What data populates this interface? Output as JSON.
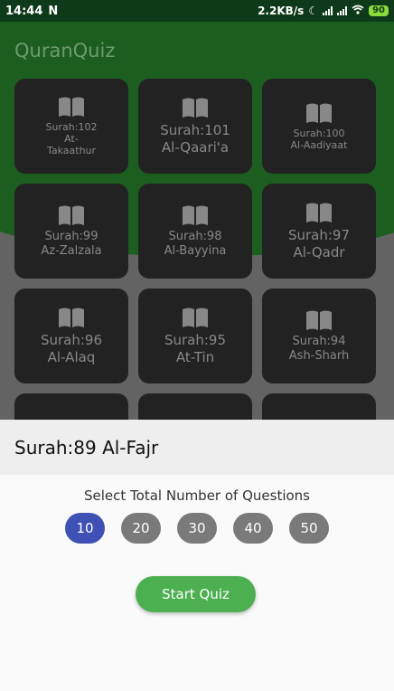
{
  "status": {
    "time": "14:44",
    "notification": "N",
    "speed": "2.2KB/s",
    "battery": "90"
  },
  "app": {
    "title": "QuranQuiz"
  },
  "surahs": [
    {
      "num": "Surah:102",
      "name": "At-\nTakaathur",
      "size": "small"
    },
    {
      "num": "Surah:101",
      "name": "Al-Qaari'a",
      "size": "big"
    },
    {
      "num": "Surah:100",
      "name": "Al-Aadiyaat",
      "size": "small"
    },
    {
      "num": "Surah:99",
      "name": "Az-Zalzala",
      "size": "normal"
    },
    {
      "num": "Surah:98",
      "name": "Al-Bayyina",
      "size": "normal"
    },
    {
      "num": "Surah:97",
      "name": "Al-Qadr",
      "size": "big"
    },
    {
      "num": "Surah:96",
      "name": "Al-Alaq",
      "size": "big"
    },
    {
      "num": "Surah:95",
      "name": "At-Tin",
      "size": "big"
    },
    {
      "num": "Surah:94",
      "name": "Ash-Sharh",
      "size": "normal"
    },
    {
      "num": "",
      "name": "",
      "size": "normal"
    },
    {
      "num": "",
      "name": "",
      "size": "normal"
    },
    {
      "num": "",
      "name": "",
      "size": "normal"
    }
  ],
  "sheet": {
    "title": "Surah:89 Al-Fajr",
    "select_label": "Select Total Number of Questions",
    "options": [
      "10",
      "20",
      "30",
      "40",
      "50"
    ],
    "selected": "10",
    "start_label": "Start Quiz"
  },
  "colors": {
    "primary": "#1b5e20",
    "accent": "#3f51b5",
    "start_button": "#4caf50"
  }
}
